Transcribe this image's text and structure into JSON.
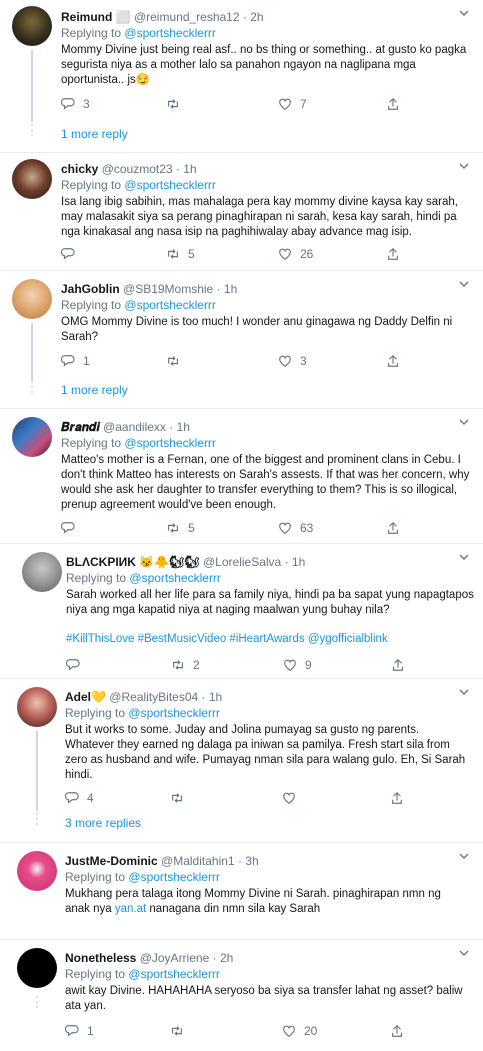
{
  "tweets": [
    {
      "name": "Reimund ⬜",
      "handle": "@reimund_resha12",
      "time": "2h",
      "replying_label": "Replying to",
      "replying_to": "@sportshecklerrr",
      "text": "Mommy Divine just being real asf.. no bs thing or something.. at gusto ko pagka segurista niya as a mother lalo sa panahon ngayon na naglipana mga oportunista.. js😏",
      "replies": "3",
      "retweets": "",
      "likes": "7",
      "more": "1 more reply"
    },
    {
      "name": "chicky",
      "handle": "@couzmot23",
      "time": "1h",
      "replying_label": "Replying to",
      "replying_to": "@sportshecklerrr",
      "text": "Isa lang ibig sabihin, mas mahalaga pera kay mommy divine kaysa kay sarah, may malasakit siya sa perang pinaghirapan ni sarah, kesa kay sarah, hindi pa nga kinakasal ang nasa isip na paghihiwalay abay advance mag isip.",
      "replies": "",
      "retweets": "5",
      "likes": "26",
      "more": ""
    },
    {
      "name": "JahGoblin",
      "handle": "@SB19Momshie",
      "time": "1h",
      "replying_label": "Replying to",
      "replying_to": "@sportshecklerrr",
      "text": "OMG Mommy Divine is too much! I wonder anu ginagawa ng Daddy Delfin ni Sarah?",
      "replies": "1",
      "retweets": "",
      "likes": "3",
      "more": "1 more reply"
    },
    {
      "name": "𝑩𝒓𝒂𝒏𝒅𝒊",
      "handle": "@aandilexx",
      "time": "1h",
      "replying_label": "Replying to",
      "replying_to": "@sportshecklerrr",
      "text": "Matteo's mother is a Fernan, one of the biggest and prominent clans in Cebu. I don't think Matteo has interests on Sarah's assests. If that was her concern, why would she ask her daughter to transfer everything to them? This is so illogical, prenup agreement would've been enough.",
      "replies": "",
      "retweets": "5",
      "likes": "63",
      "more": ""
    },
    {
      "name": "BLΛCKPIИK 😼🐥🐿🐿",
      "handle": "@LorelieSalva",
      "time": "1h",
      "replying_label": "Replying to",
      "replying_to": "@sportshecklerrr",
      "text": "Sarah worked all her life para sa family niya, hindi pa ba sapat yung napagtapos niya ang mga kapatid niya at naging maalwan yung buhay nila?",
      "hashtags": "#KillThisLove #BestMusicVideo #iHeartAwards @ygofficialblink",
      "replies": "",
      "retweets": "2",
      "likes": "9",
      "more": ""
    },
    {
      "name": "Adel💛",
      "handle": "@RealityBites04",
      "time": "1h",
      "replying_label": "Replying to",
      "replying_to": "@sportshecklerrr",
      "text": "But it works to some. Juday and Jolina pumayag sa gusto ng parents. Whatever they earned ng dalaga pa iniwan sa pamilya. Fresh start sila from zero as husband and wife. Pumayag nman sila para walang gulo. Eh, Si Sarah hindi.",
      "replies": "4",
      "retweets": "",
      "likes": "",
      "more": "3 more replies"
    },
    {
      "name": "JustMe-Dominic",
      "handle": "@Malditahin1",
      "time": "3h",
      "replying_label": "Replying to",
      "replying_to": "@sportshecklerrr",
      "text": "Mukhang pera talaga itong Mommy Divine ni Sarah. pinaghirapan nmn ng anak nya",
      "text_link": "yan.at",
      "text_tail": " nanagana din nmn sila kay Sarah",
      "replies": "",
      "retweets": "",
      "likes": "",
      "more": ""
    },
    {
      "name": "Nonetheless",
      "handle": "@JoyArriene",
      "time": "2h",
      "replying_label": "Replying to",
      "replying_to": "@sportshecklerrr",
      "text": "awit kay Divine. HAHAHAHA seryoso ba siya sa transfer lahat ng asset? baliw ata yan.",
      "replies": "1",
      "retweets": "",
      "likes": "20",
      "more": ""
    }
  ],
  "colors": {
    "link": "#1b95e0",
    "muted": "#657786",
    "divider": "#e6ecf0"
  },
  "icons": [
    "reply-icon",
    "retweet-icon",
    "like-icon",
    "share-icon",
    "chevron-down-icon"
  ]
}
